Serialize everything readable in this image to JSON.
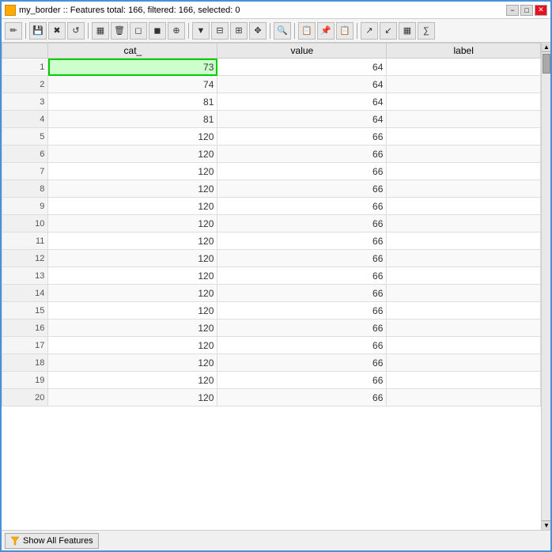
{
  "window": {
    "title": "my_border :: Features total: 166, filtered: 166, selected: 0",
    "icon": "table-icon"
  },
  "toolbar": {
    "buttons": [
      {
        "name": "pencil-icon",
        "label": "✏",
        "tooltip": "Toggle editing"
      },
      {
        "name": "save-icon",
        "label": "💾",
        "tooltip": "Save"
      },
      {
        "name": "delete-icon",
        "label": "✖",
        "tooltip": "Delete"
      },
      {
        "name": "refresh-icon",
        "label": "↺",
        "tooltip": "Reload"
      },
      {
        "name": "columns-icon",
        "label": "▦",
        "tooltip": "Columns"
      },
      {
        "name": "trash-icon",
        "label": "🗑",
        "tooltip": "Delete selected"
      },
      {
        "name": "select-all-icon",
        "label": "◻",
        "tooltip": "Select all"
      },
      {
        "name": "deselect-icon",
        "label": "◼",
        "tooltip": "Deselect all"
      },
      {
        "name": "invert-icon",
        "label": "⊕",
        "tooltip": "Invert selection"
      },
      {
        "name": "filter-icon",
        "label": "▼",
        "tooltip": "Filter"
      },
      {
        "name": "filter-form-icon",
        "label": "▦",
        "tooltip": "Filter by form"
      },
      {
        "name": "zoom-in-icon",
        "label": "⊞",
        "tooltip": "Zoom in"
      },
      {
        "name": "zoom-out-icon",
        "label": "⊟",
        "tooltip": "Zoom out"
      },
      {
        "name": "pan-icon",
        "label": "✥",
        "tooltip": "Pan"
      },
      {
        "name": "search-icon",
        "label": "🔍",
        "tooltip": "Search"
      },
      {
        "name": "copy-icon",
        "label": "📋",
        "tooltip": "Copy"
      },
      {
        "name": "paste-icon",
        "label": "📌",
        "tooltip": "Paste"
      },
      {
        "name": "clipboard-icon",
        "label": "📋",
        "tooltip": "Clipboard"
      },
      {
        "name": "export-icon",
        "label": "↗",
        "tooltip": "Export"
      },
      {
        "name": "import-icon",
        "label": "↙",
        "tooltip": "Import"
      },
      {
        "name": "grid-icon",
        "label": "▦",
        "tooltip": "Grid"
      },
      {
        "name": "calc-icon",
        "label": "∑",
        "tooltip": "Calculate"
      }
    ]
  },
  "table": {
    "columns": [
      {
        "key": "row",
        "label": ""
      },
      {
        "key": "cat_",
        "label": "cat_"
      },
      {
        "key": "value",
        "label": "value"
      },
      {
        "key": "label",
        "label": "label"
      }
    ],
    "rows": [
      {
        "row": 1,
        "cat_": 73,
        "value": 64,
        "label": ""
      },
      {
        "row": 2,
        "cat_": 74,
        "value": 64,
        "label": ""
      },
      {
        "row": 3,
        "cat_": 81,
        "value": 64,
        "label": ""
      },
      {
        "row": 4,
        "cat_": 81,
        "value": 64,
        "label": ""
      },
      {
        "row": 5,
        "cat_": 120,
        "value": 66,
        "label": ""
      },
      {
        "row": 6,
        "cat_": 120,
        "value": 66,
        "label": ""
      },
      {
        "row": 7,
        "cat_": 120,
        "value": 66,
        "label": ""
      },
      {
        "row": 8,
        "cat_": 120,
        "value": 66,
        "label": ""
      },
      {
        "row": 9,
        "cat_": 120,
        "value": 66,
        "label": ""
      },
      {
        "row": 10,
        "cat_": 120,
        "value": 66,
        "label": ""
      },
      {
        "row": 11,
        "cat_": 120,
        "value": 66,
        "label": ""
      },
      {
        "row": 12,
        "cat_": 120,
        "value": 66,
        "label": ""
      },
      {
        "row": 13,
        "cat_": 120,
        "value": 66,
        "label": ""
      },
      {
        "row": 14,
        "cat_": 120,
        "value": 66,
        "label": ""
      },
      {
        "row": 15,
        "cat_": 120,
        "value": 66,
        "label": ""
      },
      {
        "row": 16,
        "cat_": 120,
        "value": 66,
        "label": ""
      },
      {
        "row": 17,
        "cat_": 120,
        "value": 66,
        "label": ""
      },
      {
        "row": 18,
        "cat_": 120,
        "value": 66,
        "label": ""
      },
      {
        "row": 19,
        "cat_": 120,
        "value": 66,
        "label": ""
      },
      {
        "row": 20,
        "cat_": 120,
        "value": 66,
        "label": ""
      }
    ],
    "selected_cell": {
      "row": 1,
      "col": "cat_"
    }
  },
  "status_bar": {
    "button_label": "Show All Features",
    "filter_icon": "▼"
  },
  "win_buttons": {
    "minimize": "−",
    "maximize": "□",
    "close": "✕"
  }
}
